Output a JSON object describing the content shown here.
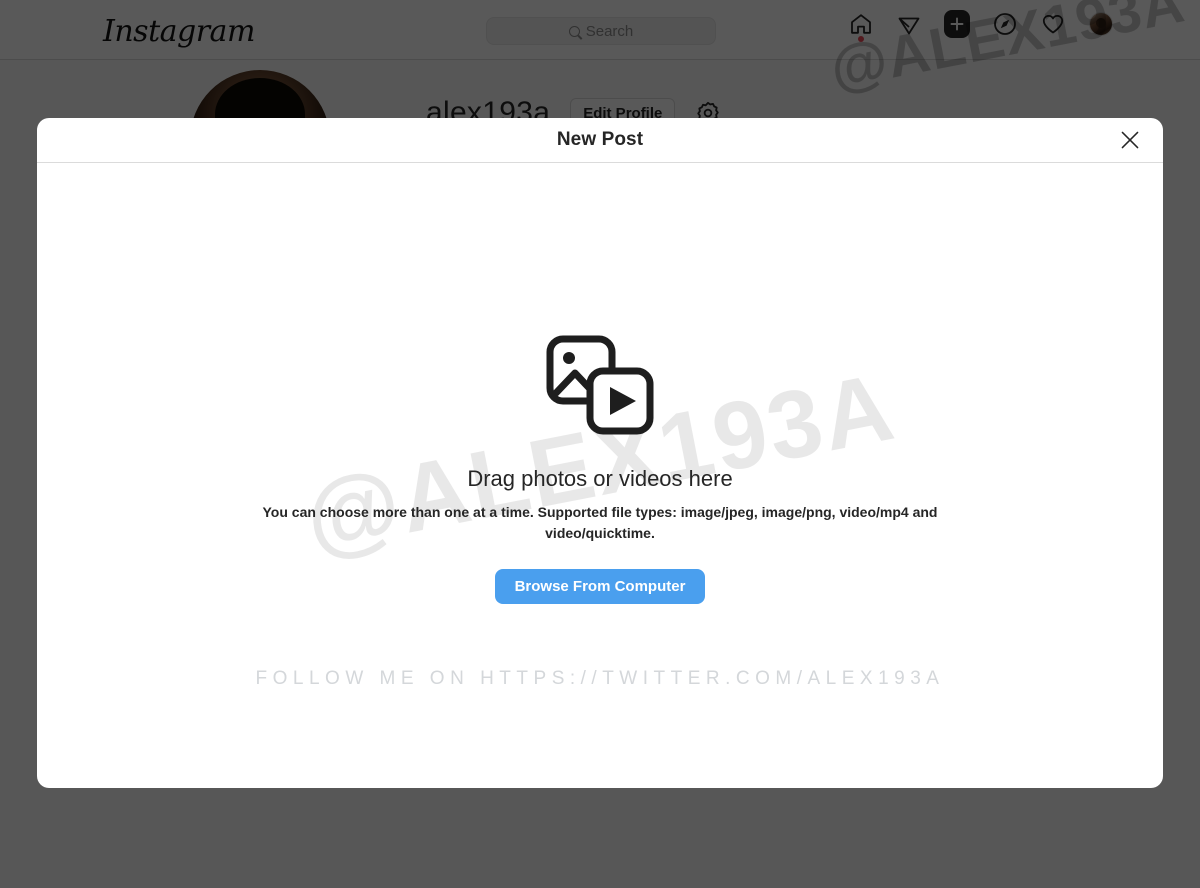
{
  "navbar": {
    "logo_text": "Instagram",
    "search": {
      "placeholder": "Search",
      "value": "",
      "icon": "search-icon"
    },
    "icons": [
      {
        "name": "home-icon",
        "label": "Home",
        "has_badge": true
      },
      {
        "name": "messenger-icon",
        "label": "Messenger",
        "has_badge": false
      },
      {
        "name": "new-post-icon",
        "label": "New post",
        "active": true
      },
      {
        "name": "explore-compass-icon",
        "label": "Explore",
        "has_badge": false
      },
      {
        "name": "heart-icon",
        "label": "Notifications",
        "has_badge": false
      },
      {
        "name": "profile-avatar",
        "label": "Profile",
        "has_badge": false
      }
    ]
  },
  "profile": {
    "username": "alex193a",
    "edit_profile_label": "Edit Profile",
    "settings_icon": "gear-icon"
  },
  "modal": {
    "title": "New Post",
    "close_label": "✕",
    "media_icon": "photo-video-stack-icon",
    "drop_title": "Drag photos or videos here",
    "drop_subtitle": "You can choose more than one at a time. Supported file types: image/jpeg, image/png, video/mp4 and video/quicktime.",
    "browse_button": "Browse From Computer"
  },
  "watermarks": {
    "handle": "@ALEX193A",
    "follow_line": "FOLLOW ME ON HTTPS://TWITTER.COM/ALEX193A"
  },
  "colors": {
    "brand_blue": "#4a9fee",
    "text_primary": "#262626",
    "text_muted": "#8e8e8e",
    "badge_red": "#ed4956",
    "overlay": "rgba(0,0,0,0.65)",
    "watermark_gray": "#d4d7da"
  }
}
